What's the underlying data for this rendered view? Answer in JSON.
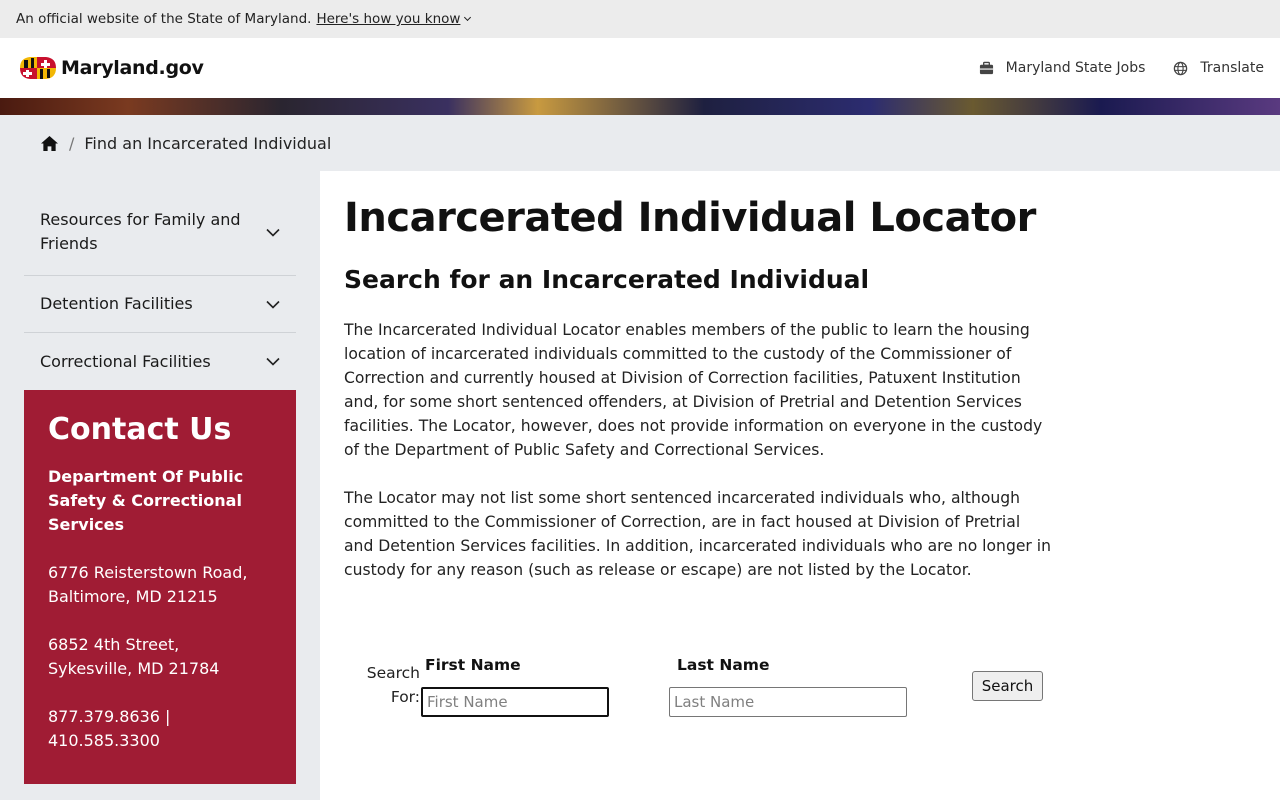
{
  "gov_banner": {
    "text": "An official website of the State of Maryland.",
    "link": "Here's how you know"
  },
  "header": {
    "logo_text": "Maryland.gov",
    "links": [
      {
        "label": "Maryland State Jobs",
        "icon": "briefcase-icon"
      },
      {
        "label": "Translate",
        "icon": "globe-icon"
      }
    ]
  },
  "breadcrumb": {
    "current": "Find an Incarcerated Individual"
  },
  "sidebar": {
    "items": [
      {
        "label": "Resources for Family and Friends"
      },
      {
        "label": "Detention Facilities"
      },
      {
        "label": "Correctional Facilities"
      }
    ]
  },
  "contact": {
    "title": "Contact Us",
    "department": "Department Of Public Safety & Correctional Services",
    "address1_line1": "6776 Reisterstown Road,",
    "address1_line2": "Baltimore, MD 21215",
    "address2_line1": "6852 4th Street,",
    "address2_line2": "Sykesville, MD 21784",
    "phones": "877.379.8636 | 410.585.3300",
    "background_color": "#a01c34"
  },
  "main": {
    "title": "Incarcerated Individual Locator",
    "subtitle": "Search for an Incarcerated Individual",
    "paragraph1": "The Incarcerated Individual Locator enables members of the public to learn the housing location of incarcerated individuals committed to the custody of the Commissioner of Correction and currently housed at Division of Correction facilities, Patuxent Institution and, for some short sentenced offenders, at Division of Pretrial and Detention Services facilities. The Locator, however, does not provide information on everyone in the custody of the Department of Public Safety and Correctional Services.",
    "paragraph2": "The Locator may not list some short sentenced incarcerated individuals who, although committed to the Commissioner of Correction, are in fact housed at Division of Pretrial and Detention Services facilities. In addition, incarcerated individuals who are no longer in custody for any reason (such as release or escape) are not listed by the Locator."
  },
  "search_form": {
    "search_for_line1": "Search",
    "search_for_line2": "For:",
    "first_name_label": "First Name",
    "first_name_placeholder": "First Name",
    "first_name_value": "",
    "last_name_label": "Last Name",
    "last_name_placeholder": "Last Name",
    "last_name_value": "",
    "search_button": "Search"
  }
}
